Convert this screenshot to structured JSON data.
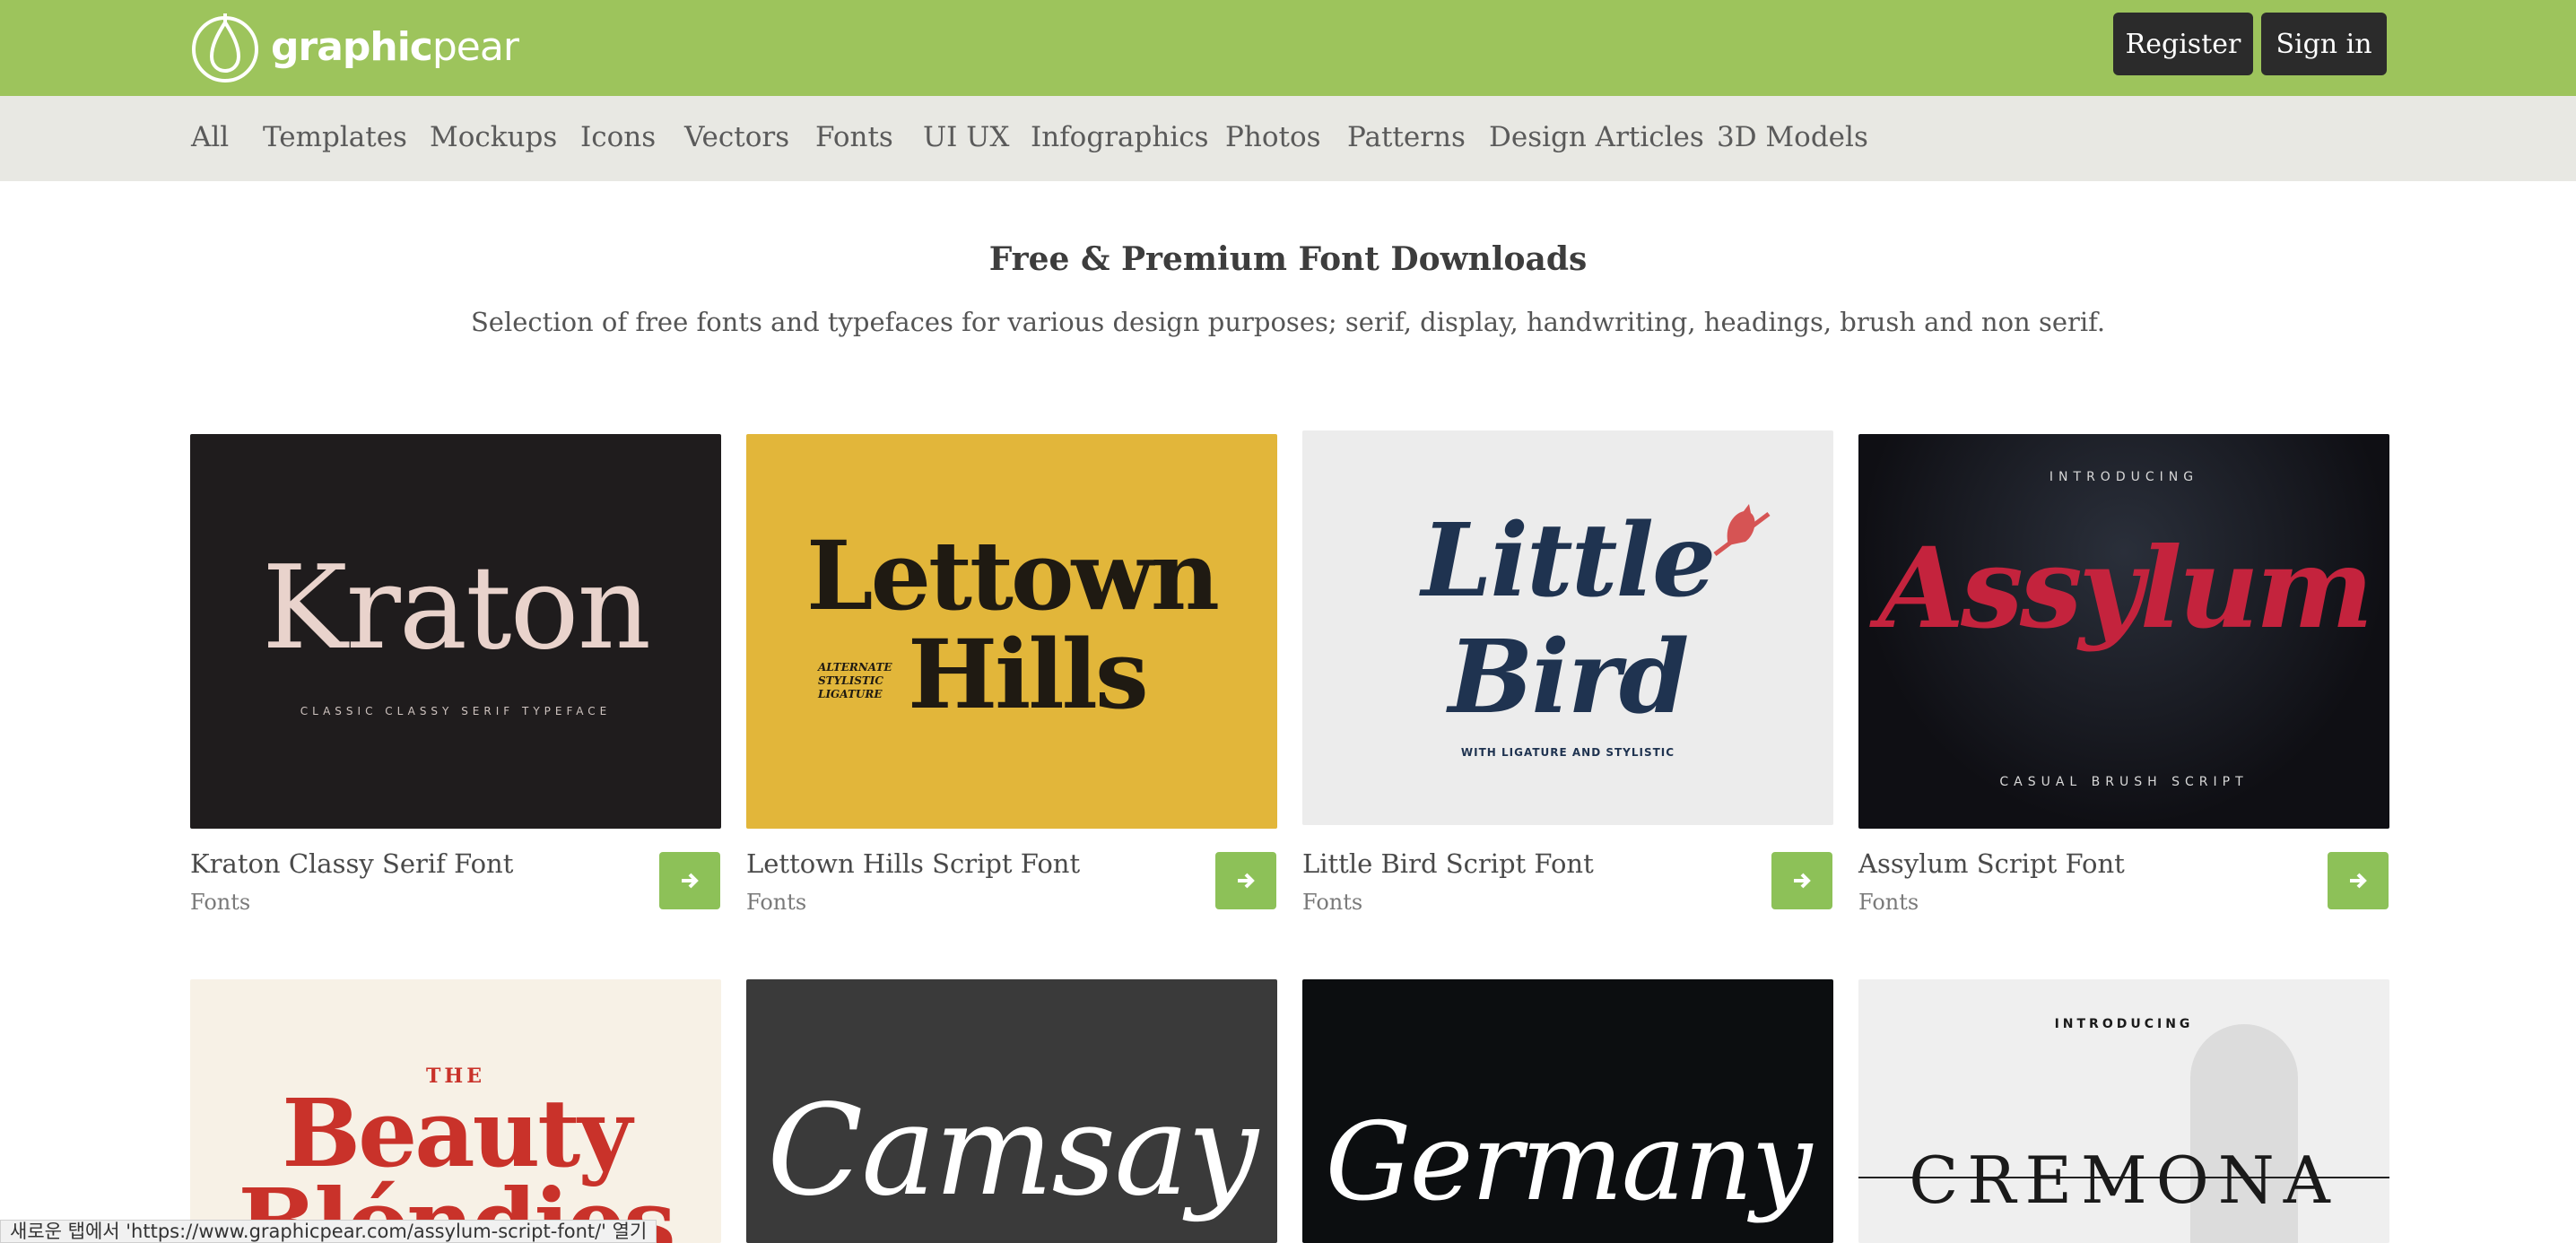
{
  "header": {
    "logo_bold": "graphic",
    "logo_light": "pear",
    "register_label": "Register",
    "signin_label": "Sign in",
    "colors": {
      "bar": "#9dc45c",
      "button": "#2b2b2b"
    }
  },
  "nav": {
    "items": [
      "All",
      "Templates",
      "Mockups",
      "Icons",
      "Vectors",
      "Fonts",
      "UI UX",
      "Infographics",
      "Photos",
      "Patterns",
      "Design Articles",
      "3D Models"
    ]
  },
  "main": {
    "title": "Free & Premium Font Downloads",
    "subtitle": "Selection of free fonts and typefaces for various design purposes; serif, display, handwriting, headings, brush and non serif."
  },
  "cards": [
    {
      "title": "Kraton Classy Serif Font",
      "category": "Fonts",
      "thumb": {
        "headline": "Kraton",
        "line1": "CLASSIC CLASSY SERIF TYPEFACE",
        "bg": "#1f1c1d",
        "fg": "#e9d3cc"
      }
    },
    {
      "title": "Lettown Hills Script Font",
      "category": "Fonts",
      "thumb": {
        "headline": "Lettown",
        "headline2": "Hills",
        "line1": "ALTERNATE",
        "line2": "STYLISTIC",
        "line3": "LIGATURE",
        "bg": "#e2b63a",
        "fg": "#1f1a12"
      }
    },
    {
      "title": "Little Bird Script Font",
      "category": "Fonts",
      "thumb": {
        "headline": "Little",
        "headline2": "Bird",
        "line1": "WITH LIGATURE AND STYLISTIC",
        "bg": "#ececec",
        "fg": "#1f3350"
      }
    },
    {
      "title": "Assylum Script Font",
      "category": "Fonts",
      "thumb": {
        "line0": "INTRODUCING",
        "headline": "Assylum",
        "line1": "CASUAL BRUSH SCRIPT",
        "bg": "#0f0f14",
        "fg": "#c4233d"
      }
    },
    {
      "thumb": {
        "line0": "THE",
        "headline": "Beauty",
        "headline2": "Blóndies",
        "bg": "#f7f1e6",
        "fg": "#c9322a"
      }
    },
    {
      "thumb": {
        "headline": "Camsay",
        "bg": "#3a3a3a",
        "fg": "#ffffff"
      }
    },
    {
      "thumb": {
        "headline": "Germany",
        "bg": "#0c0e10",
        "fg": "#ffffff"
      }
    },
    {
      "thumb": {
        "line0": "INTRODUCING",
        "headline": "CREMONA",
        "bg": "#efefef",
        "fg": "#1a1a1a"
      }
    }
  ],
  "statusbar": {
    "text": "새로운 탭에서 'https://www.graphicpear.com/assylum-script-font/' 열기"
  },
  "icons": {
    "logo": "pear-icon",
    "go": "arrow-right-icon"
  },
  "accent": "#8dc158"
}
